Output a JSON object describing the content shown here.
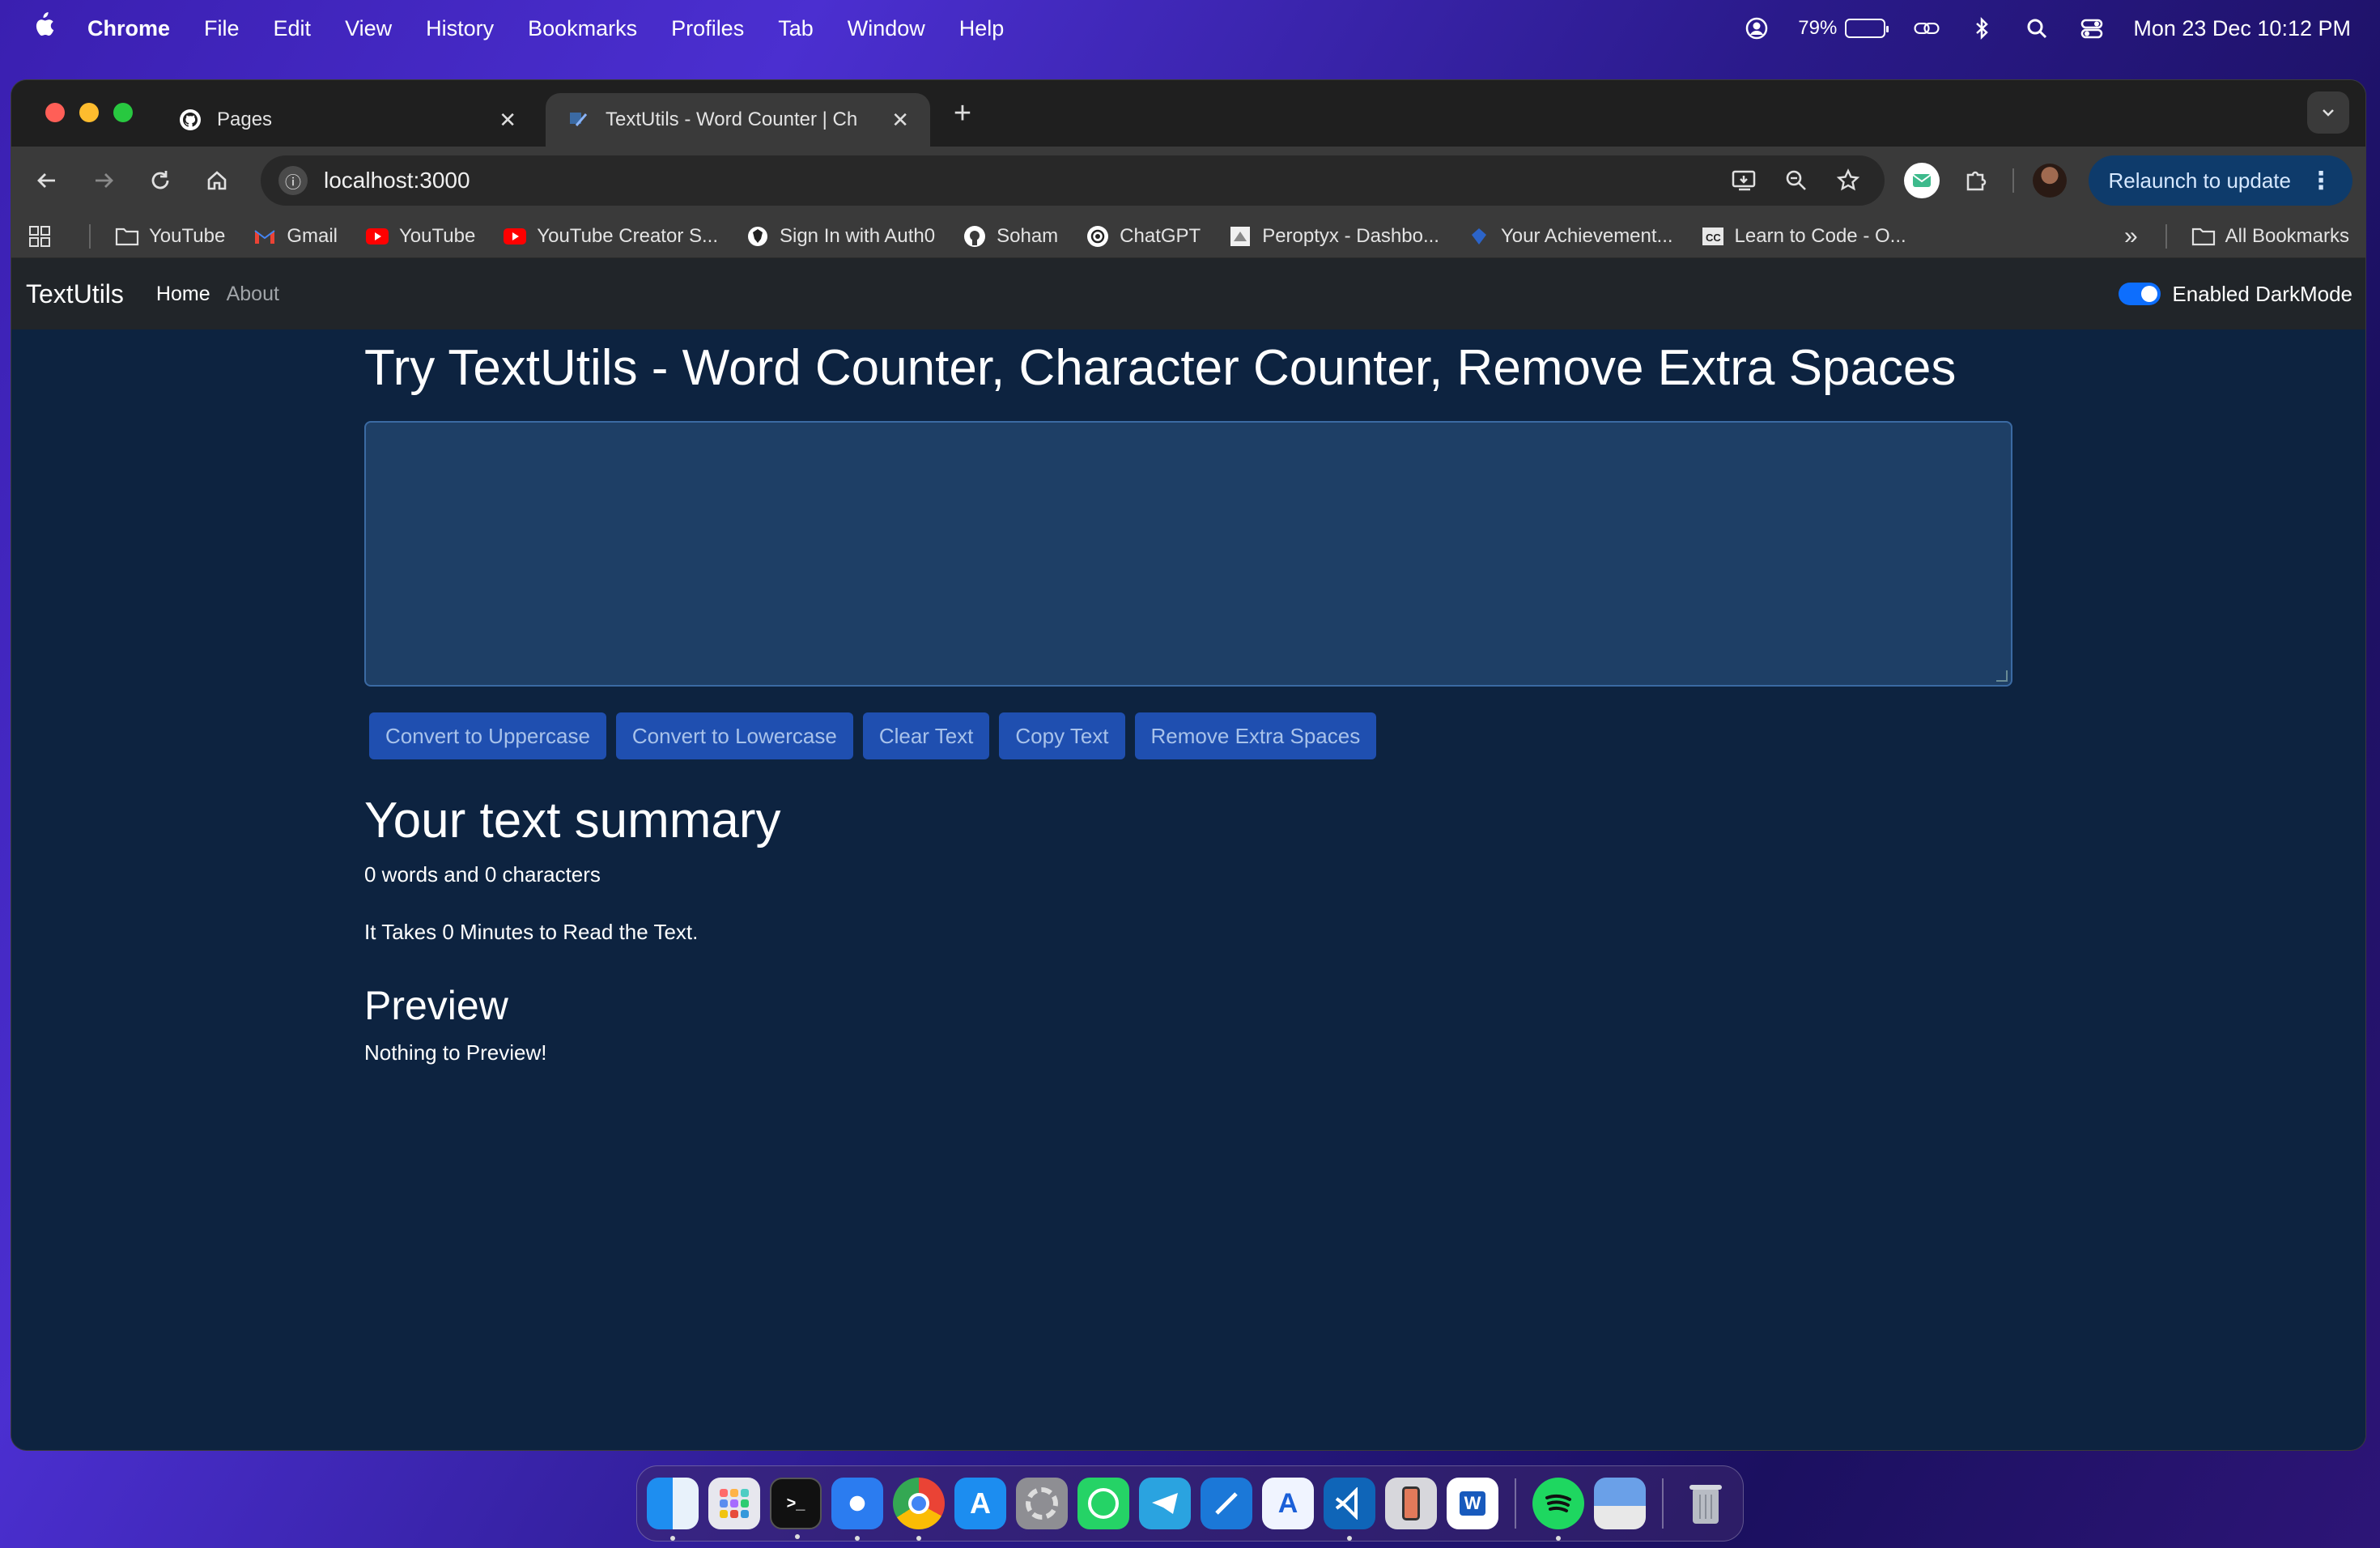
{
  "menubar": {
    "app": "Chrome",
    "items": [
      "File",
      "Edit",
      "View",
      "History",
      "Bookmarks",
      "Profiles",
      "Tab",
      "Window",
      "Help"
    ],
    "battery": "79%",
    "datetime": "Mon 23 Dec  10:12 PM"
  },
  "browser": {
    "tabs": [
      {
        "title": "Pages"
      },
      {
        "title": "TextUtils - Word Counter | Ch"
      }
    ],
    "url": "localhost:3000",
    "relaunch": "Relaunch to update",
    "bookmarks": [
      {
        "label": "YouTube",
        "icon": "folder-icon"
      },
      {
        "label": "Gmail",
        "icon": "gmail-icon"
      },
      {
        "label": "YouTube",
        "icon": "youtube-icon"
      },
      {
        "label": "YouTube Creator S...",
        "icon": "youtube-icon"
      },
      {
        "label": "Sign In with Auth0",
        "icon": "auth0-icon"
      },
      {
        "label": "Soham",
        "icon": "github-icon"
      },
      {
        "label": "ChatGPT",
        "icon": "chatgpt-icon"
      },
      {
        "label": "Peroptyx - Dashbo...",
        "icon": "peroptyx-icon"
      },
      {
        "label": "Your Achievement...",
        "icon": "achievement-icon"
      },
      {
        "label": "Learn to Code - O...",
        "icon": "freecodecamp-icon"
      }
    ],
    "all_bookmarks": "All Bookmarks"
  },
  "app": {
    "brand": "TextUtils",
    "nav": [
      "Home",
      "About"
    ],
    "darkmode_label": "Enabled DarkMode",
    "heading": "Try TextUtils - Word Counter, Character Counter, Remove Extra Spaces",
    "textarea_value": "",
    "buttons": [
      "Convert to Uppercase",
      "Convert to Lowercase",
      "Clear Text",
      "Copy Text",
      "Remove Extra Spaces"
    ],
    "summary_heading": "Your text summary",
    "summary_counts": "0 words and 0 characters",
    "read_time": "It Takes 0 Minutes to Read the Text.",
    "preview_heading": "Preview",
    "preview_text": "Nothing to Preview!"
  },
  "colors": {
    "page_bg": "#0d2340",
    "textarea_bg": "#1e3f66",
    "button_bg": "#1f4fb0",
    "navbar_bg": "#212529",
    "toggle_on": "#0d6efd"
  },
  "dock": [
    "Finder",
    "Launchpad",
    "Terminal",
    "Safari",
    "Chrome",
    "App Store",
    "System Settings",
    "WhatsApp",
    "Telegram",
    "Xcode",
    "Instruments",
    "VS Code",
    "Simulator",
    "Word",
    "Spotify",
    "Preview",
    "Trash"
  ]
}
